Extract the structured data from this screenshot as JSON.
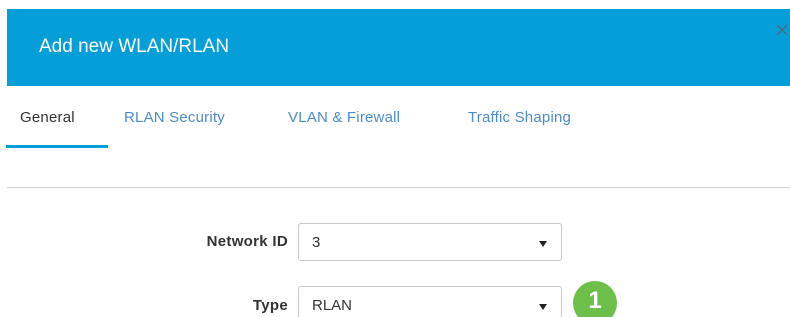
{
  "dialog": {
    "title": "Add new WLAN/RLAN",
    "close_icon": "close-icon"
  },
  "tabs": [
    {
      "label": "General",
      "active": true
    },
    {
      "label": "RLAN Security",
      "active": false
    },
    {
      "label": "VLAN & Firewall",
      "active": false
    },
    {
      "label": "Traffic Shaping",
      "active": false
    }
  ],
  "form": {
    "network_id": {
      "label": "Network ID",
      "value": "3"
    },
    "type": {
      "label": "Type",
      "value": "RLAN"
    }
  },
  "step_badge": "1",
  "colors": {
    "header": "#049fd9",
    "tab_link": "#4d8cc8",
    "badge": "#6cc04a"
  }
}
